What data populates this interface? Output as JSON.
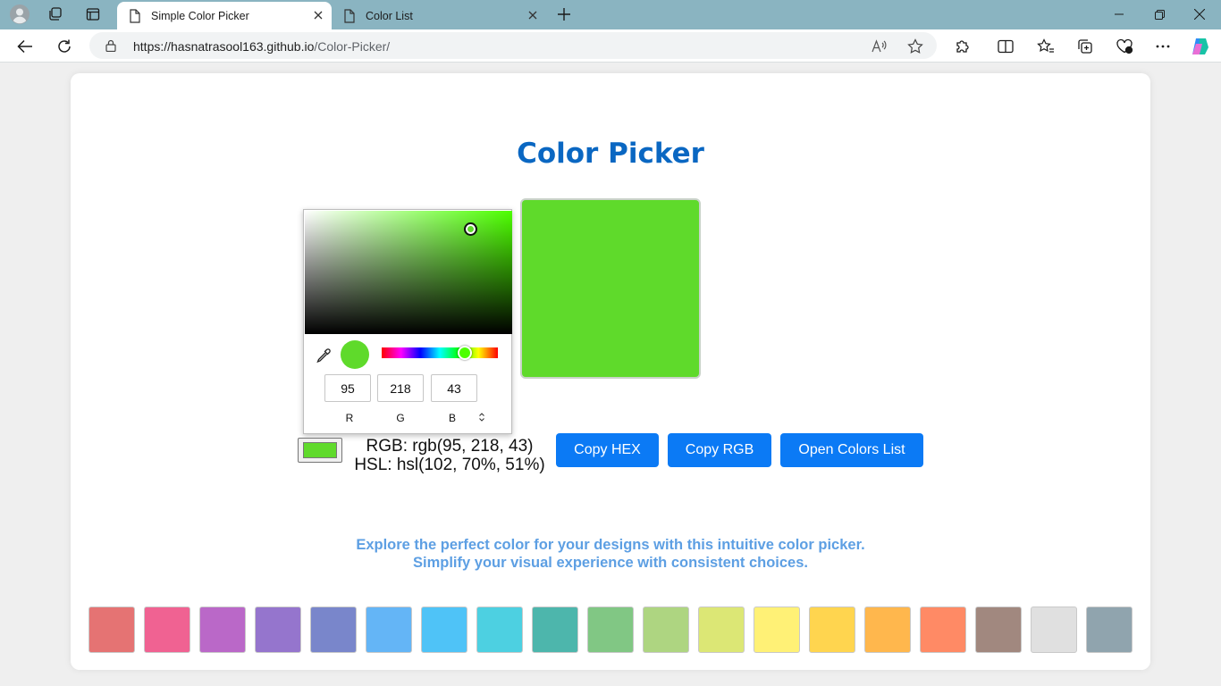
{
  "browser": {
    "tabs": [
      {
        "label": "Simple Color Picker",
        "active": true
      },
      {
        "label": "Color List",
        "active": false
      }
    ],
    "url_host": "https://hasnatrasool163.github.io",
    "url_path": "/Color-Picker/",
    "icons": {
      "profile": "profile-icon",
      "workspaces": "workspaces-icon",
      "tab_actions": "tab-actions-icon",
      "new_tab": "plus-icon",
      "back": "back-arrow-icon",
      "refresh": "refresh-icon",
      "lock": "lock-icon",
      "read_aloud": "read-aloud-icon",
      "favorite": "star-icon",
      "extensions": "extensions-icon",
      "split_screen": "split-screen-icon",
      "favorites": "favorites-icon",
      "collections": "collections-icon",
      "performance": "performance-icon",
      "more": "more-icon",
      "copilot": "copilot-icon"
    }
  },
  "page": {
    "title": "Color Picker",
    "selected_color": "#5fda2b",
    "picker": {
      "r": "95",
      "g": "218",
      "b": "43",
      "r_label": "R",
      "g_label": "G",
      "b_label": "B",
      "hue_deg": 102,
      "saturation_pct": 80,
      "value_pct": 85
    },
    "rgb_text": "RGB: rgb(95, 218, 43)",
    "hsl_text": "HSL: hsl(102, 70%, 51%)",
    "buttons": {
      "copy_hex": "Copy HEX",
      "copy_rgb": "Copy RGB",
      "open_list": "Open Colors List"
    },
    "description_line1": "Explore the perfect color for your designs with this intuitive color picker.",
    "description_line2": "Simplify your visual experience with consistent choices.",
    "palette": [
      "#e57373",
      "#f06292",
      "#ba68c8",
      "#9575cd",
      "#7986cb",
      "#64b5f6",
      "#4fc3f7",
      "#4dd0e1",
      "#4db6ac",
      "#81c784",
      "#aed581",
      "#dce775",
      "#fff176",
      "#ffd54f",
      "#ffb74d",
      "#ff8a65",
      "#a1887f",
      "#e0e0e0",
      "#90a4ae"
    ]
  },
  "colors": {
    "accent_blue": "#0b7af5",
    "title_blue": "#0a67c2",
    "desc_blue": "#5d9fe3",
    "chrome_teal": "#8ab4c1"
  }
}
